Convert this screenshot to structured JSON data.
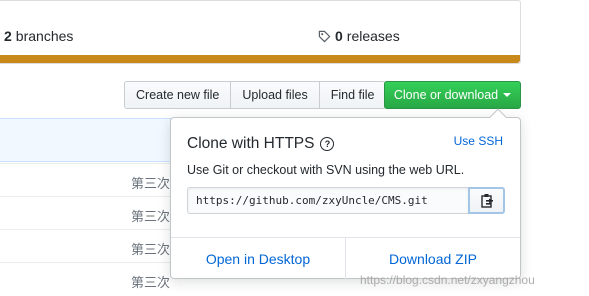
{
  "stats": {
    "branches_count": "2",
    "branches_label": "branches",
    "releases_count": "0",
    "releases_label": "releases",
    "progress_color": "#c9891a"
  },
  "file_nav": {
    "create_new_file": "Create new file",
    "upload_files": "Upload files",
    "find_file": "Find file",
    "clone_or_download": "Clone or download"
  },
  "files": {
    "rows": [
      {
        "message": "第三次"
      },
      {
        "message": "第三次"
      },
      {
        "message": "第三次"
      },
      {
        "message": "第三次"
      }
    ]
  },
  "clone_popover": {
    "title": "Clone with HTTPS",
    "help_icon": "question-icon",
    "use_ssh": "Use SSH",
    "description": "Use Git or checkout with SVN using the web URL.",
    "url": "https://github.com/zxyUncle/CMS.git",
    "copy_icon": "clipboard-icon",
    "open_in_desktop": "Open in Desktop",
    "download_zip": "Download ZIP"
  },
  "watermark": "https://blog.csdn.net/zxyangzhou",
  "colors": {
    "clone_button": "#28a745",
    "link": "#0366d6"
  }
}
